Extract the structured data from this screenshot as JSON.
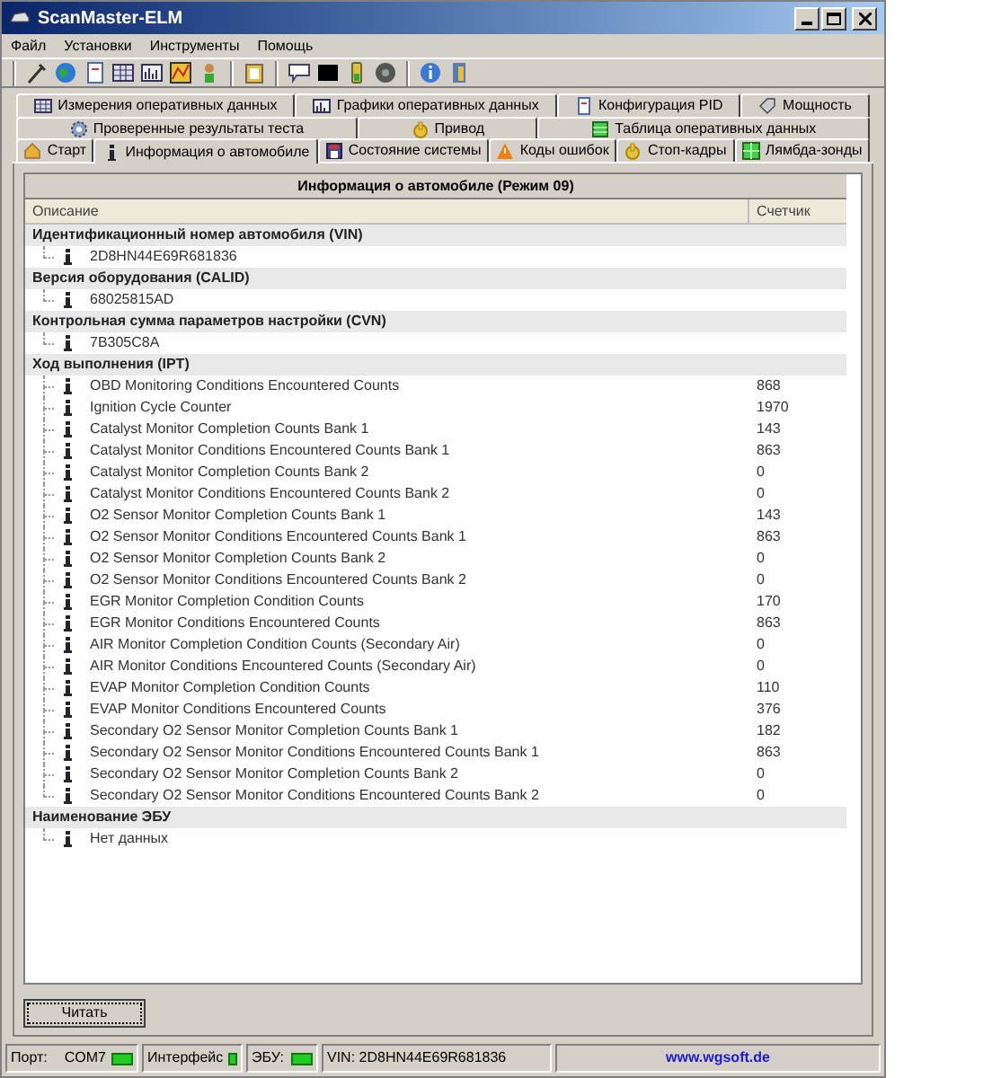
{
  "window": {
    "title": "ScanMaster-ELM"
  },
  "menu": [
    "Файл",
    "Установки",
    "Инструменты",
    "Помощь"
  ],
  "tab_rows": [
    [
      {
        "label": "Измерения оперативных данных",
        "selected": false
      },
      {
        "label": "Графики оперативных данных",
        "selected": false
      },
      {
        "label": "Конфигурация PID",
        "selected": false
      },
      {
        "label": "Мощность",
        "selected": false
      }
    ],
    [
      {
        "label": "Проверенные результаты теста",
        "selected": false
      },
      {
        "label": "Привод",
        "selected": false
      },
      {
        "label": "Таблица оперативных данных",
        "selected": false
      }
    ],
    [
      {
        "label": "Старт",
        "selected": false
      },
      {
        "label": "Информация о автомобиле",
        "selected": true
      },
      {
        "label": "Состояние системы",
        "selected": false
      },
      {
        "label": "Коды ошибок",
        "selected": false
      },
      {
        "label": "Стоп-кадры",
        "selected": false
      },
      {
        "label": "Лямбда-зонды",
        "selected": false
      }
    ]
  ],
  "panel": {
    "title": "Информация о автомобиле (Режим 09)",
    "columns": [
      "Описание",
      "Счетчик"
    ],
    "sections": [
      {
        "title": "Идентификационный номер автомобиля (VIN)",
        "items": [
          {
            "description": "2D8HN44E69R681836"
          }
        ]
      },
      {
        "title": "Версия оборудования (CALID)",
        "items": [
          {
            "description": "68025815AD"
          }
        ]
      },
      {
        "title": "Контрольная сумма параметров настройки (CVN)",
        "items": [
          {
            "description": "7B305C8A"
          }
        ]
      },
      {
        "title": "Ход выполнения (IPT)",
        "items": [
          {
            "description": "OBD Monitoring Conditions Encountered Counts",
            "count": "868"
          },
          {
            "description": "Ignition  Cycle Counter",
            "count": "1970"
          },
          {
            "description": "Catalyst Monitor Completion Counts Bank 1",
            "count": "143"
          },
          {
            "description": "Catalyst Monitor Conditions Encountered Counts Bank 1",
            "count": "863"
          },
          {
            "description": "Catalyst Monitor Completion Counts Bank 2",
            "count": "0"
          },
          {
            "description": "Catalyst Monitor Conditions Encountered Counts Bank 2",
            "count": "0"
          },
          {
            "description": "O2 Sensor Monitor Completion Counts Bank 1",
            "count": "143"
          },
          {
            "description": "O2 Sensor Monitor Conditions Encountered Counts Bank 1",
            "count": "863"
          },
          {
            "description": "O2 Sensor Monitor Completion Counts Bank 2",
            "count": "0"
          },
          {
            "description": "O2 Sensor Monitor Conditions Encountered Counts Bank 2",
            "count": "0"
          },
          {
            "description": "EGR Monitor Completion Condition Counts",
            "count": "170"
          },
          {
            "description": "EGR Monitor Conditions Encountered Counts",
            "count": "863"
          },
          {
            "description": "AIR Monitor Completion Condition Counts (Secondary Air)",
            "count": "0"
          },
          {
            "description": "AIR Monitor Conditions Encountered Counts (Secondary Air)",
            "count": "0"
          },
          {
            "description": "EVAP Monitor Completion Condition Counts",
            "count": "110"
          },
          {
            "description": "EVAP Monitor Conditions Encountered Counts",
            "count": "376"
          },
          {
            "description": "Secondary O2 Sensor Monitor Completion Counts Bank 1",
            "count": "182"
          },
          {
            "description": "Secondary O2 Sensor Monitor Conditions Encountered Counts Bank 1",
            "count": "863"
          },
          {
            "description": "Secondary O2 Sensor Monitor Completion Counts Bank 2",
            "count": "0"
          },
          {
            "description": "Secondary O2 Sensor Monitor Conditions Encountered Counts Bank 2",
            "count": "0"
          }
        ]
      },
      {
        "title": "Наименование ЭБУ",
        "items": [
          {
            "description": "Нет данных"
          }
        ]
      }
    ]
  },
  "read_button": "Читать",
  "status_bar": {
    "port_label": "Порт:",
    "port": "COM7",
    "port_led_on": true,
    "interface_label": "Интерфейс",
    "interface_led_on": true,
    "ecu_label": "ЭБУ:",
    "ecu_led_on": true,
    "vin": "VIN: 2D8HN44E69R681836",
    "link": "www.wgsoft.de"
  }
}
